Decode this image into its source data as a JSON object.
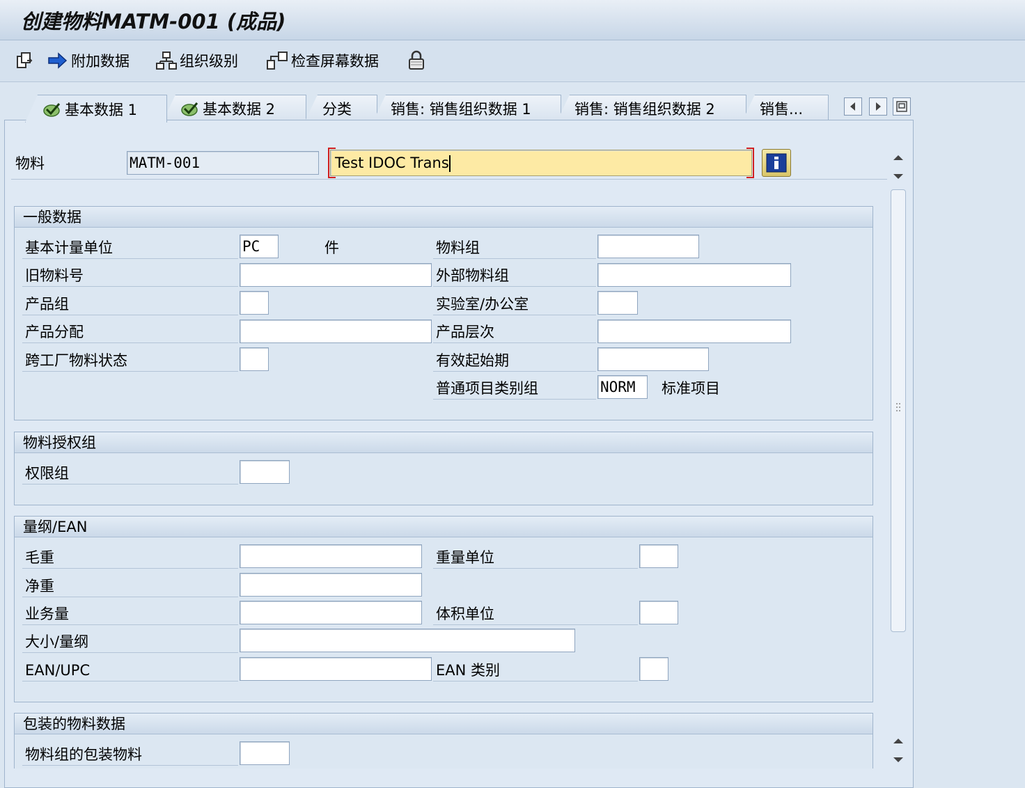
{
  "title": "创建物料MATM-001 (成品)",
  "toolbar": {
    "additional_data": "附加数据",
    "org_levels": "组织级别",
    "check_screen": "检查屏幕数据"
  },
  "tabs": [
    "基本数据 1",
    "基本数据 2",
    "分类",
    "销售: 销售组织数据 1",
    "销售: 销售组织数据 2",
    "销售..."
  ],
  "header": {
    "material_label": "物料",
    "material_value": "MATM-001",
    "description_value": "Test IDOC Trans"
  },
  "general": {
    "title": "一般数据",
    "base_uom_label": "基本计量单位",
    "base_uom_value": "PC",
    "base_uom_text": "件",
    "old_material_label": "旧物料号",
    "product_group_label": "产品组",
    "product_allocation_label": "产品分配",
    "cross_plant_status_label": "跨工厂物料状态",
    "material_group_label": "物料组",
    "ext_material_group_label": "外部物料组",
    "lab_office_label": "实验室/办公室",
    "product_hierarchy_label": "产品层次",
    "valid_from_label": "有效起始期",
    "item_category_group_label": "普通项目类别组",
    "item_category_group_value": "NORM",
    "item_category_group_text": "标准项目"
  },
  "auth": {
    "title": "物料授权组",
    "auth_group_label": "权限组"
  },
  "dims": {
    "title": "量纲/EAN",
    "gross_weight_label": "毛重",
    "net_weight_label": "净重",
    "volume_label": "业务量",
    "size_dims_label": "大小/量纲",
    "ean_upc_label": "EAN/UPC",
    "weight_unit_label": "重量单位",
    "volume_unit_label": "体积单位",
    "ean_category_label": "EAN 类别"
  },
  "packaging": {
    "title": "包装的物料数据",
    "mat_group_pack_label": "物料组的包装物料"
  }
}
